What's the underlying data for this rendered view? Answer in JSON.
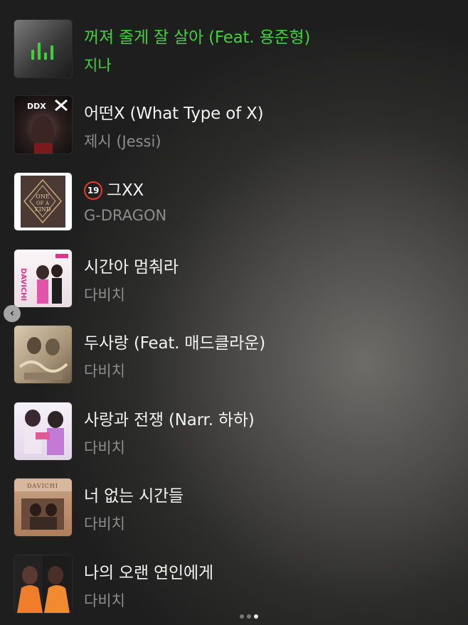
{
  "tracks": [
    {
      "title": "꺼져 줄게 잘 살아 (Feat. 용준형)",
      "artist": "지나",
      "playing": true,
      "explicit": false,
      "art_colors": [
        "#6b6b6b",
        "#2a2a2a"
      ]
    },
    {
      "title": "어떤X (What Type of X)",
      "artist": "제시 (Jessi)",
      "playing": false,
      "explicit": false,
      "art_colors": [
        "#3a2a2a",
        "#0d0d0d"
      ]
    },
    {
      "title": "그XX",
      "artist": "G-DRAGON",
      "playing": false,
      "explicit": true,
      "explicit_label": "19",
      "art_colors": [
        "#4a3832",
        "#2b1f1b"
      ]
    },
    {
      "title": "시간아 멈춰라",
      "artist": "다비치",
      "playing": false,
      "explicit": false,
      "art_colors": [
        "#f4eef0",
        "#d8c7cf"
      ]
    },
    {
      "title": "두사랑 (Feat. 매드클라운)",
      "artist": "다비치",
      "playing": false,
      "explicit": false,
      "art_colors": [
        "#c9b69a",
        "#8e7d66"
      ]
    },
    {
      "title": "사랑과 전쟁 (Narr. 하하)",
      "artist": "다비치",
      "playing": false,
      "explicit": false,
      "art_colors": [
        "#f3eef6",
        "#cbb6d3"
      ]
    },
    {
      "title": "너 없는 시간들",
      "artist": "다비치",
      "playing": false,
      "explicit": false,
      "art_colors": [
        "#c49a7c",
        "#8b5a40"
      ]
    },
    {
      "title": "나의 오랜 연인에게",
      "artist": "다비치",
      "playing": false,
      "explicit": false,
      "art_colors": [
        "#f07d2a",
        "#2a2a2a"
      ]
    }
  ],
  "theme": {
    "accent": "#3fd13a",
    "explicit_badge": "#e53b2f"
  },
  "pager": {
    "count": 3,
    "active": 2
  },
  "back_button_icon": "chevron-left-icon"
}
